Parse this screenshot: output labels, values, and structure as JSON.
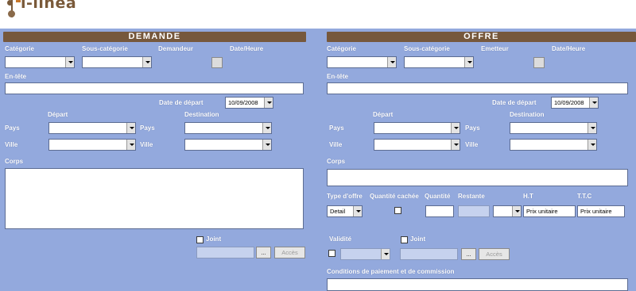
{
  "logo": {
    "text": "i-linea"
  },
  "demande": {
    "title": "DEMANDE",
    "categorie_label": "Catégorie",
    "sous_categorie_label": "Sous-catégorie",
    "demandeur_label": "Demandeur",
    "date_heure_label": "Date/Heure",
    "entete_label": "En-tête",
    "date_depart_label": "Date de départ",
    "date_depart_value": "10/09/2008",
    "depart_label": "Départ",
    "destination_label": "Destination",
    "pays_label": "Pays",
    "ville_label": "Ville",
    "corps_label": "Corps",
    "joint_label": "Joint",
    "browse_label": "...",
    "acces_label": "Accès"
  },
  "offre": {
    "title": "OFFRE",
    "categorie_label": "Catégorie",
    "sous_categorie_label": "Sous-catégorie",
    "emetteur_label": "Emetteur",
    "date_heure_label": "Date/Heure",
    "entete_label": "En-tête",
    "date_depart_label": "Date de départ",
    "date_depart_value": "10/09/2008",
    "depart_label": "Départ",
    "destination_label": "Destination",
    "pays_label": "Pays",
    "ville_label": "Ville",
    "corps_label": "Corps",
    "type_offre_label": "Type d'offre",
    "type_offre_value": "Detail",
    "quantite_cachee_label": "Quantité cachée",
    "quantite_label": "Quantité",
    "restante_label": "Restante",
    "ht_label": "H.T",
    "ttc_label": "T.T.C",
    "ht_value": "Prix unitaire",
    "ttc_value": "Prix unitaire",
    "validite_label": "Validité",
    "joint_label": "Joint",
    "browse_label": "...",
    "acces_label": "Accès",
    "conditions_label": "Conditions de paiement et de commission"
  },
  "colors": {
    "background": "#93a9dd",
    "header": "#76583c",
    "logo": "#7a5a3a"
  }
}
